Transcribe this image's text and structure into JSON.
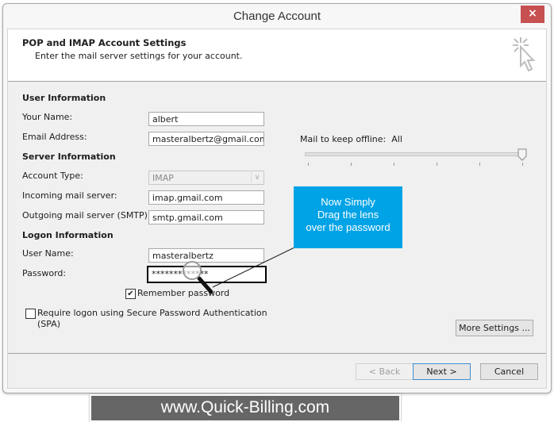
{
  "window": {
    "title": "Change Account",
    "close_label": "×"
  },
  "header": {
    "title": "POP and IMAP Account Settings",
    "subtitle": "Enter the mail server settings for your account."
  },
  "user_info": {
    "heading": "User Information",
    "name_label": "Your Name:",
    "name_value": "albert",
    "email_label": "Email Address:",
    "email_value": "masteralbertz@gmail.com"
  },
  "server_info": {
    "heading": "Server Information",
    "account_type_label": "Account Type:",
    "account_type_value": "IMAP",
    "incoming_label": "Incoming mail server:",
    "incoming_value": "imap.gmail.com",
    "outgoing_label": "Outgoing mail server (SMTP):",
    "outgoing_value": "smtp.gmail.com"
  },
  "logon_info": {
    "heading": "Logon Information",
    "username_label": "User Name:",
    "username_value": "masteralbertz",
    "password_label": "Password:",
    "password_value": "*************",
    "remember_label": "Remember password",
    "remember_checked": true,
    "spa_label": "Require logon using Secure Password Authentication (SPA)",
    "spa_checked": false
  },
  "offline": {
    "label": "Mail to keep offline:",
    "value": "All",
    "slider_position": 1.0,
    "tick_count": 6
  },
  "callout": {
    "line1": "Now Simply",
    "line2": "Drag the lens",
    "line3": "over the password"
  },
  "buttons": {
    "more_settings": "More Settings ...",
    "back": "< Back",
    "next": "Next >",
    "cancel": "Cancel"
  },
  "banner": {
    "text": "www.Quick-Billing.com"
  },
  "colors": {
    "close": "#c75050",
    "callout": "#00a3e6",
    "banner": "#666666",
    "default_button_border": "#3c8ed6"
  }
}
